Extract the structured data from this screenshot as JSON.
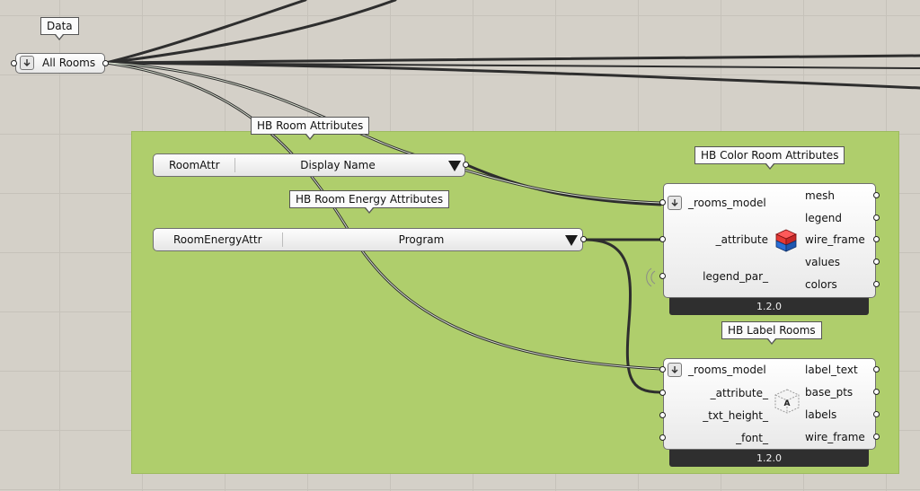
{
  "data_param": {
    "tag": "Data",
    "label": "All Rooms",
    "icon": "down-arrow-icon"
  },
  "room_attr": {
    "tag": "HB Room Attributes",
    "name": "RoomAttr",
    "value": "Display Name"
  },
  "energy_attr": {
    "tag": "HB Room Energy Attributes",
    "name": "RoomEnergyAttr",
    "value": "Program"
  },
  "color_room": {
    "tag": "HB Color Room Attributes",
    "inputs": [
      "_rooms_model",
      "_attribute",
      "legend_par_"
    ],
    "outputs": [
      "mesh",
      "legend",
      "wire_frame",
      "values",
      "colors"
    ],
    "version": "1.2.0",
    "icon": "colored-cube-icon"
  },
  "label_rooms": {
    "tag": "HB Label Rooms",
    "inputs": [
      "_rooms_model",
      "_attribute_",
      "_txt_height_",
      "_font_"
    ],
    "outputs": [
      "label_text",
      "base_pts",
      "labels",
      "wire_frame"
    ],
    "version": "1.2.0",
    "icon": "label-cube-icon"
  },
  "colors": {
    "canvas": "#d4d0c8",
    "group": "#afce6c",
    "wire": "#2e2e2e",
    "version_bar": "#2f2f2f",
    "cube_red": "#e53935",
    "cube_blue": "#2a6fd6"
  }
}
